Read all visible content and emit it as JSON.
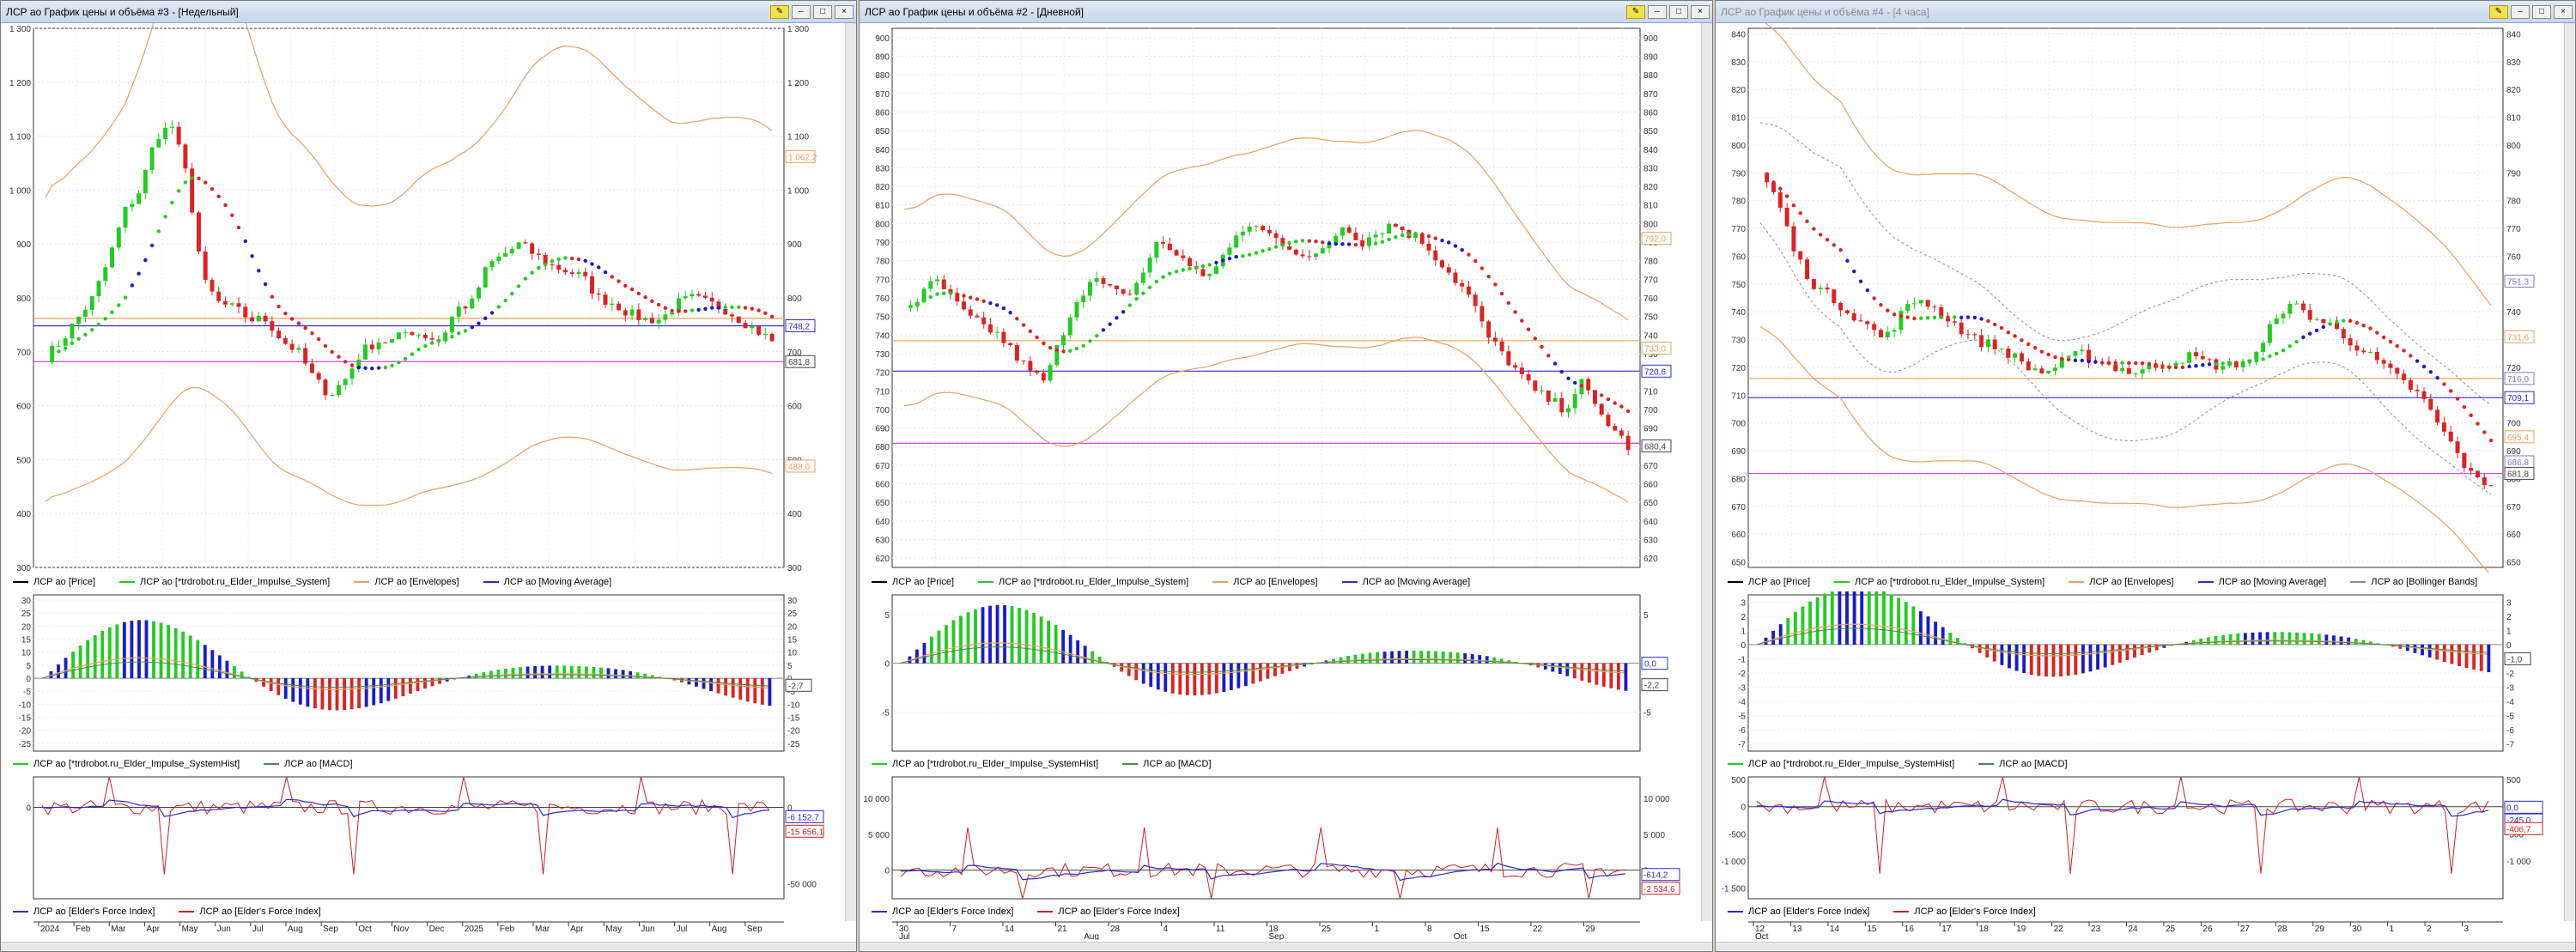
{
  "windows": [
    {
      "id": "w3",
      "title": "ЛСР ао График цены и объёма #3 - [Недельный]",
      "active": true,
      "price_pane": {
        "ylim": [
          300,
          1300
        ],
        "ticks": [
          "1 300",
          "1 200",
          "1 100",
          "1 000",
          "900",
          "800",
          "700",
          "600",
          "500",
          "400",
          "300"
        ],
        "tick_values": [
          1300,
          1200,
          1100,
          1000,
          900,
          800,
          700,
          600,
          500,
          400,
          300
        ],
        "h_lines": [
          {
            "value": 748.2,
            "color": "#2b2bd0"
          },
          {
            "value": 681.8,
            "color": "#e040e0"
          },
          {
            "value": 762,
            "color": "#e8a060"
          }
        ],
        "badges": [
          {
            "value": 1062.2,
            "text": "1 062,2",
            "color": "#e8a060"
          },
          {
            "value": 748.2,
            "text": "748,2",
            "color": "#2b2bd0"
          },
          {
            "value": 681.8,
            "text": "681,8",
            "color": "#444"
          },
          {
            "value": 488,
            "text": "488,0",
            "color": "#e8a060"
          }
        ]
      },
      "price_legend": [
        "ЛСР ао [Price]",
        "ЛСР ао [*trdrobot.ru_Elder_Impulse_System]",
        "ЛСР ао [Envelopes]",
        "ЛСР ао [Moving Average]"
      ],
      "macd_pane": {
        "ylim": [
          -28,
          32
        ],
        "ticks": [
          "30",
          "25",
          "20",
          "15",
          "10",
          "5",
          "0",
          "-5",
          "-10",
          "-15",
          "-20",
          "-25"
        ],
        "tick_values": [
          30,
          25,
          20,
          15,
          10,
          5,
          0,
          -5,
          -10,
          -15,
          -20,
          -25
        ],
        "badges": [
          {
            "value": 2,
            "text": "",
            "color": "#2b2bd0"
          },
          {
            "value": -2.7,
            "text": "-2,7",
            "color": "#444"
          }
        ]
      },
      "macd_legend": [
        "ЛСР ао [*trdrobot.ru_Elder_Impulse_SystemHist]",
        "ЛСР ао [MACD]"
      ],
      "fi_pane": {
        "ylim": [
          -60000,
          20000
        ],
        "ticks_left": [
          "0"
        ],
        "tick_values_left": [
          0
        ],
        "ticks_right": [
          "0",
          "-50 000"
        ],
        "tick_values_right": [
          0,
          -50000
        ],
        "badges": [
          {
            "value": -6152,
            "text": "-6 152,7",
            "color": "#2b2bd0"
          },
          {
            "value": -15656,
            "text": "-15 656,1",
            "color": "#d02020"
          }
        ]
      },
      "fi_legend": [
        "ЛСР ао [Elder's Force Index]",
        "ЛСР ао [Elder's Force Index]"
      ],
      "time_labels": [
        "2024",
        "Feb",
        "Mar",
        "Apr",
        "May",
        "Jun",
        "Jul",
        "Aug",
        "Sep",
        "Oct",
        "Nov",
        "Dec",
        "2025",
        "Feb",
        "Mar",
        "Apr",
        "May",
        "Jun",
        "Jul",
        "Aug",
        "Sep"
      ]
    },
    {
      "id": "w2",
      "title": "ЛСР ао График цены и объёма #2 - [Дневной]",
      "active": true,
      "price_pane": {
        "ylim": [
          615,
          905
        ],
        "ticks": [
          "900",
          "890",
          "880",
          "870",
          "860",
          "850",
          "840",
          "830",
          "820",
          "810",
          "800",
          "790",
          "780",
          "770",
          "760",
          "750",
          "740",
          "730",
          "720",
          "710",
          "700",
          "690",
          "680",
          "670",
          "660",
          "650",
          "640",
          "630",
          "620"
        ],
        "tick_values": [
          900,
          890,
          880,
          870,
          860,
          850,
          840,
          830,
          820,
          810,
          800,
          790,
          780,
          770,
          760,
          750,
          740,
          730,
          720,
          710,
          700,
          690,
          680,
          670,
          660,
          650,
          640,
          630,
          620
        ],
        "h_lines": [
          {
            "value": 720.6,
            "color": "#2b2bd0"
          },
          {
            "value": 681.8,
            "color": "#e040e0"
          },
          {
            "value": 737,
            "color": "#e8a060"
          }
        ],
        "badges": [
          {
            "value": 792,
            "text": "792,0",
            "color": "#e8a060"
          },
          {
            "value": 733,
            "text": "733,0",
            "color": "#e8a060"
          },
          {
            "value": 720.6,
            "text": "720,6",
            "color": "#2b2bd0"
          },
          {
            "value": 680.4,
            "text": "680,4",
            "color": "#444"
          }
        ]
      },
      "price_legend": [
        "ЛСР ао [Price]",
        "ЛСР ао [*trdrobot.ru_Elder_Impulse_System]",
        "ЛСР ао [Envelopes]",
        "ЛСР ао [Moving Average]"
      ],
      "macd_pane": {
        "ylim": [
          -9,
          7
        ],
        "ticks": [
          "5",
          "0",
          "-5"
        ],
        "tick_values": [
          5,
          0,
          -5
        ],
        "badges": [
          {
            "value": 0,
            "text": "0,0",
            "color": "#2b2bd0"
          },
          {
            "value": -2.2,
            "text": "-2,2",
            "color": "#444"
          }
        ]
      },
      "macd_legend": [
        "ЛСР ао [*trdrobot.ru_Elder_Impulse_SystemHist]",
        "ЛСР ао [MACD]"
      ],
      "fi_pane": {
        "ylim": [
          -4000,
          13000
        ],
        "ticks_left": [
          "10 000",
          "5 000",
          "0"
        ],
        "tick_values_left": [
          10000,
          5000,
          0
        ],
        "ticks_right": [
          "10 000",
          "5 000",
          "0"
        ],
        "tick_values_right": [
          10000,
          5000,
          0
        ],
        "badges": [
          {
            "value": -614,
            "text": "-614,2",
            "color": "#2b2bd0"
          },
          {
            "value": -2534,
            "text": "-2 534,6",
            "color": "#d02020"
          }
        ]
      },
      "fi_legend": [
        "ЛСР ао [Elder's Force Index]",
        "ЛСР ао [Elder's Force Index]"
      ],
      "time_labels": [
        "30",
        "7",
        "14",
        "21",
        "28",
        "4",
        "11",
        "18",
        "25",
        "1",
        "8",
        "15",
        "22",
        "29"
      ],
      "time_labels_2": [
        "Jul",
        "Aug",
        "Sep",
        "Oct"
      ]
    },
    {
      "id": "w4",
      "title": "ЛСР ао График цены и объёма #4 - [4 часа]",
      "active": false,
      "price_pane": {
        "ylim": [
          648,
          842
        ],
        "ticks": [
          "840",
          "830",
          "820",
          "810",
          "800",
          "790",
          "780",
          "770",
          "760",
          "750",
          "740",
          "730",
          "720",
          "710",
          "700",
          "690",
          "680",
          "670",
          "660",
          "650"
        ],
        "tick_values": [
          840,
          830,
          820,
          810,
          800,
          790,
          780,
          770,
          760,
          750,
          740,
          730,
          720,
          710,
          700,
          690,
          680,
          670,
          660,
          650
        ],
        "h_lines": [
          {
            "value": 709.1,
            "color": "#2b2bd0"
          },
          {
            "value": 681.8,
            "color": "#e040e0"
          },
          {
            "value": 716,
            "color": "#e8a060"
          }
        ],
        "badges": [
          {
            "value": 751,
            "text": "751,3",
            "color": "#7b7bd0"
          },
          {
            "value": 731,
            "text": "731,6",
            "color": "#e8a060"
          },
          {
            "value": 716,
            "text": "716,0",
            "color": "#7b7bd0"
          },
          {
            "value": 709.1,
            "text": "709,1",
            "color": "#2b2bd0"
          },
          {
            "value": 695,
            "text": "695,4",
            "color": "#e8a060"
          },
          {
            "value": 686,
            "text": "686,8",
            "color": "#7b7bd0"
          },
          {
            "value": 681.8,
            "text": "681,8",
            "color": "#444"
          }
        ]
      },
      "price_legend": [
        "ЛСР ао [Price]",
        "ЛСР ао [*trdrobot.ru_Elder_Impulse_System]",
        "ЛСР ао [Envelopes]",
        "ЛСР ао [Moving Average]",
        "ЛСР ао [Bollinger Bands]"
      ],
      "macd_pane": {
        "ylim": [
          -7.5,
          3.5
        ],
        "ticks": [
          "3",
          "2",
          "1",
          "0",
          "-1",
          "-2",
          "-3",
          "-4",
          "-5",
          "-6",
          "-7"
        ],
        "tick_values": [
          3,
          2,
          1,
          0,
          -1,
          -2,
          -3,
          -4,
          -5,
          -6,
          -7
        ],
        "badges": [
          {
            "value": -0.3,
            "text": "",
            "color": "#2b2bd0"
          },
          {
            "value": -1,
            "text": "-1,0",
            "color": "#444"
          }
        ]
      },
      "macd_legend": [
        "ЛСР ао [*trdrobot.ru_Elder_Impulse_SystemHist]",
        "ЛСР ао [MACD]"
      ],
      "fi_pane": {
        "ylim": [
          -1700,
          550
        ],
        "ticks_left": [
          "500",
          "0",
          "-500",
          "-1 000",
          "-1 500"
        ],
        "tick_values_left": [
          500,
          0,
          -500,
          -1000,
          -1500
        ],
        "ticks_right": [
          "500",
          "0",
          "-500",
          "-1 000"
        ],
        "tick_values_right": [
          500,
          0,
          -500,
          -1000
        ],
        "badges": [
          {
            "value": -10,
            "text": "0,0",
            "color": "#2b2bd0"
          },
          {
            "value": -245,
            "text": "-245,0",
            "color": "#2b2bd0"
          },
          {
            "value": -406,
            "text": "-406,7",
            "color": "#d02020"
          }
        ]
      },
      "fi_legend": [
        "ЛСР ао [Elder's Force Index]",
        "ЛСР ао [Elder's Force Index]"
      ],
      "time_labels": [
        "12",
        "13",
        "14",
        "15",
        "16",
        "17",
        "18",
        "19",
        "22",
        "23",
        "24",
        "25",
        "26",
        "27",
        "28",
        "29",
        "30",
        "1",
        "2",
        "3"
      ],
      "time_labels_2": [
        "Oct"
      ]
    }
  ],
  "colors": {
    "bull": "#22cc22",
    "bear": "#dd2222",
    "blue": "#1a1acc",
    "envelope": "#e8a060",
    "ma": "#2b2bd0",
    "level": "#e040e0",
    "bb": "#8a8aa8",
    "macd_line": "#e8a060",
    "macd_signal": "#4a8a4a",
    "fi_fast": "#d02020",
    "fi_slow": "#2b2bd0"
  },
  "chart_data": [
    {
      "type": "line",
      "title": "ЛСР ао График цены и объёма #3 - [Недельный]",
      "series": [
        {
          "name": "ЛСР ао [Price]",
          "values": [
            690,
            720,
            760,
            800,
            870,
            960,
            1000,
            1100,
            1120,
            1020,
            830,
            790,
            780,
            760,
            760,
            720,
            700,
            650,
            620,
            650,
            700,
            720,
            720,
            740,
            730,
            720,
            780,
            790,
            860,
            880,
            900,
            880,
            860,
            850,
            840,
            800,
            790,
            770,
            760,
            760,
            790,
            800,
            790,
            780,
            760,
            740,
            720
          ]
        },
        {
          "name": "ЛСР ао [Moving Average]",
          "values": [
            748.2
          ]
        }
      ],
      "ylim": [
        300,
        1300
      ]
    },
    {
      "type": "line",
      "title": "ЛСР ао График цены и объёма #2 - [Дневной]",
      "series": [
        {
          "name": "ЛСР ао [Price]",
          "values": [
            755,
            760,
            770,
            760,
            750,
            745,
            740,
            730,
            720,
            715,
            740,
            760,
            770,
            765,
            760,
            770,
            790,
            785,
            780,
            770,
            780,
            790,
            800,
            795,
            790,
            785,
            780,
            790,
            800,
            790,
            795,
            800,
            795,
            790,
            780,
            770,
            760,
            740,
            730,
            720,
            710,
            705,
            700,
            715,
            700,
            690,
            680
          ]
        },
        {
          "name": "ЛСР ао [Moving Average]",
          "values": [
            720.6
          ]
        }
      ],
      "ylim": [
        615,
        905
      ]
    },
    {
      "type": "line",
      "title": "ЛСР ао График цены и объёма #4 - [4 часа]",
      "series": [
        {
          "name": "ЛСР ао [Price]",
          "values": [
            790,
            780,
            760,
            750,
            745,
            740,
            735,
            730,
            740,
            745,
            740,
            735,
            730,
            728,
            725,
            720,
            718,
            722,
            725,
            722,
            720,
            718,
            720,
            722,
            724,
            722,
            720,
            722,
            725,
            740,
            742,
            738,
            735,
            730,
            725,
            720,
            715,
            710,
            700,
            690,
            680,
            678
          ]
        },
        {
          "name": "ЛСР ао [Moving Average]",
          "values": [
            709.1
          ]
        }
      ],
      "ylim": [
        648,
        842
      ]
    }
  ]
}
